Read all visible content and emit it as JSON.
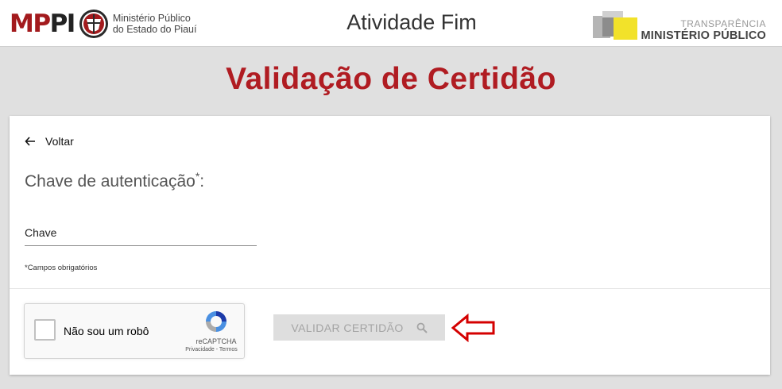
{
  "header": {
    "logo_text_red": "MP",
    "logo_text_dark": "PI",
    "org_name_line1": "Ministério Público",
    "org_name_line2": "do Estado do Piauí",
    "title": "Atividade Fim",
    "transparency_small": "TRANSPARÊNCIA",
    "transparency_big": "MINISTÉRIO PÚBLICO"
  },
  "page": {
    "title": "Validação de Certidão"
  },
  "form": {
    "back_label": "Voltar",
    "field_label": "Chave de autenticação",
    "field_required_mark": "*",
    "field_colon": ":",
    "key_placeholder": "Chave",
    "key_value": "",
    "required_note": "*Campos obrigatórios",
    "validate_label": "VALIDAR CERTIDÃO"
  },
  "captcha": {
    "label": "Não sou um robô",
    "brand": "reCAPTCHA",
    "links": "Privacidade - Termos",
    "checked": false
  },
  "icons": {
    "back": "arrow-left-icon",
    "search": "search-icon",
    "annotation": "red-outline-arrow-icon",
    "recaptcha": "recaptcha-logo-icon"
  },
  "colors": {
    "brand_red": "#b01c22",
    "page_background": "#e0e0e0",
    "button_disabled_bg": "#dedede",
    "button_disabled_text": "#a4a4a4",
    "annotation_red": "#d40000"
  }
}
